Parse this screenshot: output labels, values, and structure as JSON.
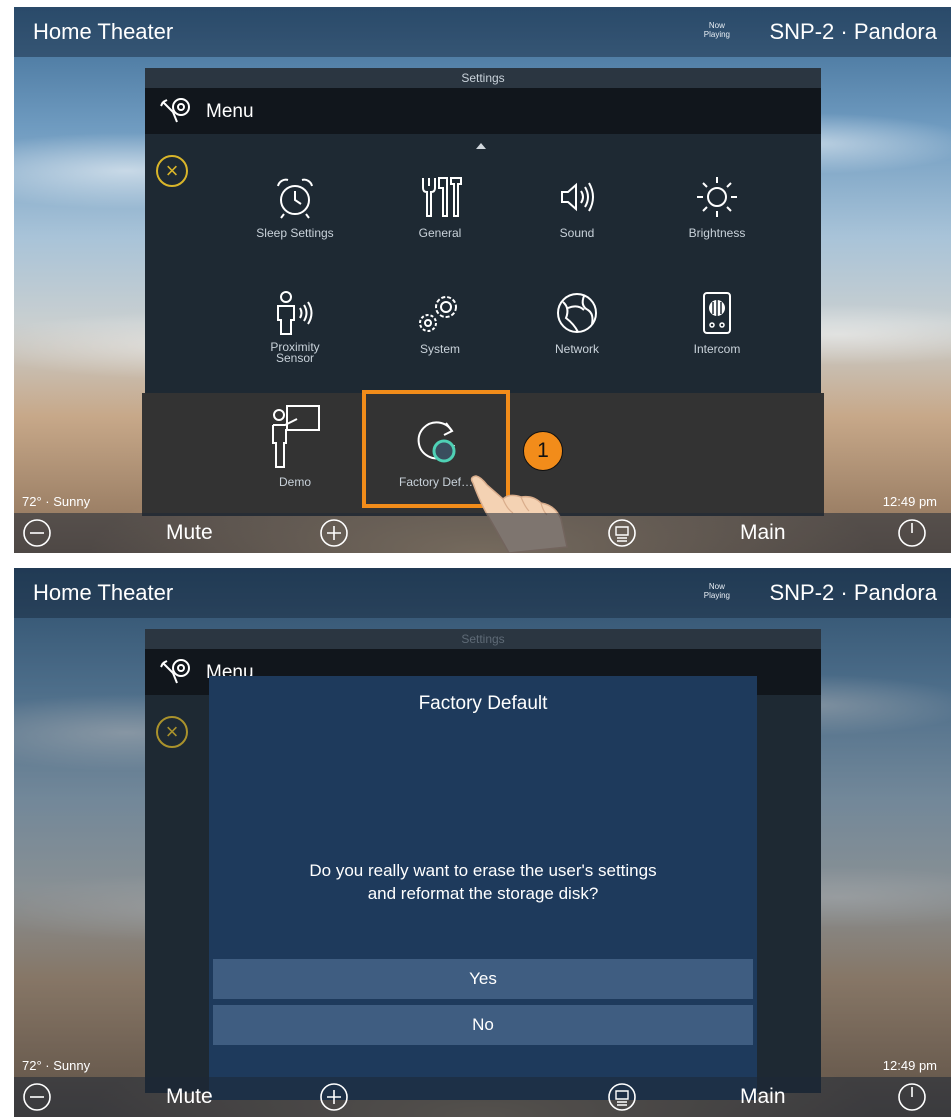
{
  "header": {
    "title": "Home Theater",
    "now_playing_top": "Now",
    "now_playing_bottom": "Playing",
    "source": "SNP-2 · Pandora"
  },
  "settings": {
    "title": "Settings",
    "menu_label": "Menu",
    "tiles": [
      {
        "label": "Sleep Settings",
        "icon": "alarm-clock-icon"
      },
      {
        "label": "General",
        "icon": "tools-icon"
      },
      {
        "label": "Sound",
        "icon": "speaker-icon"
      },
      {
        "label": "Brightness",
        "icon": "sun-icon"
      },
      {
        "label": "Proximity\nSensor",
        "icon": "proximity-sensor-icon"
      },
      {
        "label": "System",
        "icon": "gears-icon"
      },
      {
        "label": "Network",
        "icon": "globe-icon"
      },
      {
        "label": "Intercom",
        "icon": "intercom-icon"
      },
      {
        "label": "Demo",
        "icon": "presenter-icon"
      },
      {
        "label": "Factory Def…",
        "icon": "factory-reset-icon"
      }
    ]
  },
  "callout": {
    "step": "1"
  },
  "status": {
    "weather": "72° · Sunny",
    "time": "12:49 pm"
  },
  "footer": {
    "mute": "Mute",
    "main": "Main"
  },
  "dialog": {
    "title": "Factory Default",
    "message_line1": "Do you really want to erase the user's settings",
    "message_line2": "and reformat the storage disk?",
    "yes": "Yes",
    "no": "No"
  },
  "colors": {
    "accent_orange": "#f28c1a",
    "close_yellow": "#d9b52a",
    "dialog_blue": "#1e3a5c",
    "dialog_button": "#3f5d81"
  }
}
